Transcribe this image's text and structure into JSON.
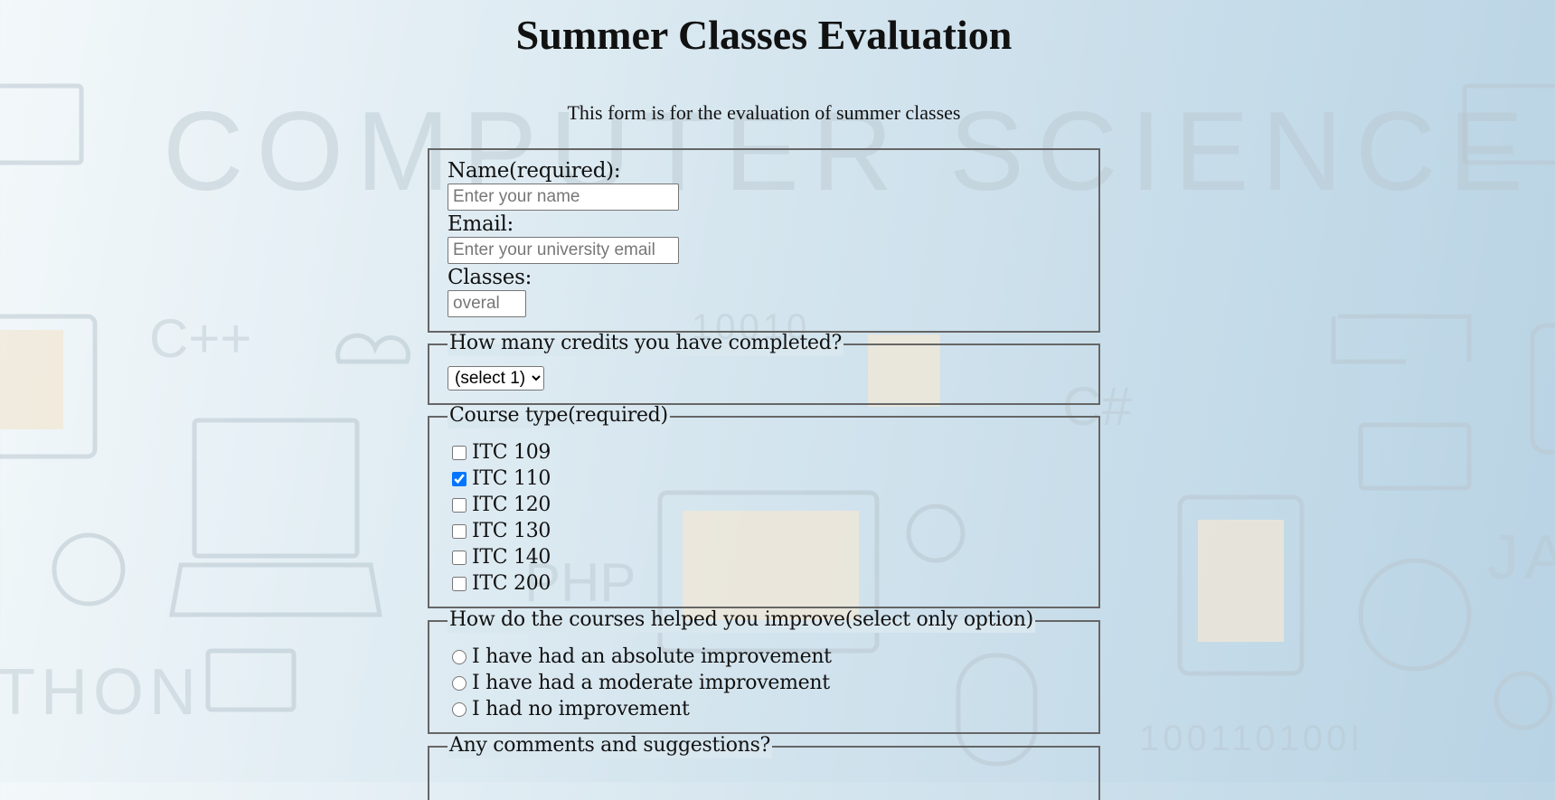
{
  "title": "Summer Classes Evaluation",
  "subtitle": "This form is for the evaluation of summer classes",
  "personal": {
    "name_label": "Name(required):",
    "name_placeholder": "Enter your name",
    "email_label": "Email:",
    "email_placeholder": "Enter your university email",
    "classes_label": "Classes:",
    "classes_placeholder": "overal"
  },
  "credits": {
    "legend": "How many credits you have completed?",
    "selected": "(select 1)"
  },
  "course_type": {
    "legend": "Course type(required)",
    "options": [
      {
        "label": "ITC 109",
        "checked": false
      },
      {
        "label": "ITC 110",
        "checked": true
      },
      {
        "label": "ITC 120",
        "checked": false
      },
      {
        "label": "ITC 130",
        "checked": false
      },
      {
        "label": "ITC 140",
        "checked": false
      },
      {
        "label": "ITC 200",
        "checked": false
      }
    ]
  },
  "improvement": {
    "legend": "How do the courses helped you improve(select only option)",
    "options": [
      "I have had an absolute improvement",
      "I have had a moderate improvement",
      "I had no improvement"
    ]
  },
  "comments": {
    "legend": "Any comments and suggestions?"
  },
  "background_text": {
    "banner": "COMPUTER SCIENCE",
    "cpp": "C++",
    "binary_top": "10010",
    "binary_bottom": "100110100I",
    "csharp": "C#",
    "php": "PHP",
    "python": "THON",
    "java": "JAV"
  }
}
